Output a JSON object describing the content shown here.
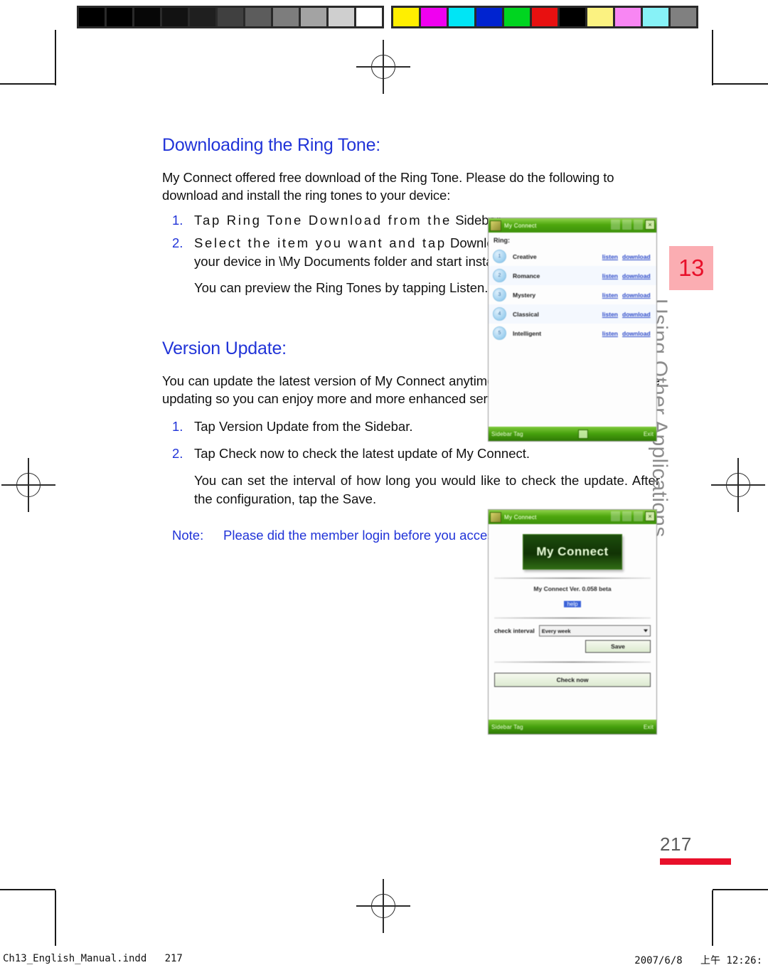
{
  "calibration": {
    "grayscale_swatches": [
      "#000000",
      "#000000",
      "#070707",
      "#121212",
      "#1f1f1f",
      "#404040",
      "#5c5c5c",
      "#7d7d7d",
      "#a3a3a3",
      "#cfcfcf",
      "#ffffff"
    ],
    "color_swatches": [
      "#ffef00",
      "#f000f0",
      "#00e5f5",
      "#0023d0",
      "#00d520",
      "#e81010",
      "#000000",
      "#fbf281",
      "#f886f3",
      "#87f2f7",
      "#808080"
    ]
  },
  "document": {
    "heading_color": "#2134d8",
    "accent_red": "#e8102a"
  },
  "section_one": {
    "heading": "Downloading the Ring Tone:",
    "intro": "My Connect offered free download of the Ring Tone. Please do the following to download and install the ring tones to your device:",
    "steps": [
      {
        "num": "1.",
        "text": "Tap Ring Tone Download from the",
        "text2": "Sidebar."
      },
      {
        "num": "2.",
        "text": "Select the item you want and tap",
        "text2": "Download. The file will be saved to your device in \\My Documents folder and start installing automatically."
      }
    ],
    "sub_para": "You can preview the Ring Tones by tapping Listen."
  },
  "section_two": {
    "heading": "Version Update:",
    "intro": "You can update the latest version of My Connect anytime you want. Keep your device updating so you can enjoy more and more enhanced services My Connect offered.",
    "steps": [
      {
        "num": "1.",
        "text": "Tap Version Update from the Sidebar."
      },
      {
        "num": "2.",
        "text": "Tap Check now to check the latest update of My Connect."
      }
    ],
    "sub_para": "You can set the interval of how long you would like to check the update. After the configuration, tap the Save.",
    "note_label": "Note:",
    "note_text": "Please did the member login before you access the service."
  },
  "chapter": {
    "number": "13",
    "title": "Using Other Applications",
    "tab_bg": "#fbadb2",
    "number_color": "#e8102a",
    "title_color": "#8d8d8d"
  },
  "page_number": "217",
  "footer": {
    "left": "Ch13_English_Manual.indd   217",
    "right": "2007/6/8   上午 12:26:"
  },
  "device_ringtone": {
    "title": "My Connect",
    "tray_icons": [
      "signal-icon",
      "volume-icon",
      "speaker-icon"
    ],
    "close_label": "×",
    "list_heading": "Ring:",
    "rows": [
      {
        "index": "1",
        "name": "Creative",
        "listen": "listen",
        "download": "download"
      },
      {
        "index": "2",
        "name": "Romance",
        "listen": "listen",
        "download": "download"
      },
      {
        "index": "3",
        "name": "Mystery",
        "listen": "listen",
        "download": "download"
      },
      {
        "index": "4",
        "name": "Classical",
        "listen": "listen",
        "download": "download"
      },
      {
        "index": "5",
        "name": "Intelligent",
        "listen": "listen",
        "download": "download"
      }
    ],
    "softkey_left": "Sidebar Tag",
    "softkey_right": "Exit"
  },
  "device_version": {
    "title": "My Connect",
    "tray_icons": [
      "sync-icon",
      "signal-icon",
      "speaker-icon"
    ],
    "close_label": "×",
    "logo_text": "My Connect",
    "version_text": "My Connect Ver. 0.058 beta",
    "help_link": "help",
    "interval_label": "check interval",
    "interval_value": "Every week",
    "save_label": "Save",
    "check_now_label": "Check now",
    "softkey_left": "Sidebar Tag",
    "softkey_right": "Exit"
  }
}
